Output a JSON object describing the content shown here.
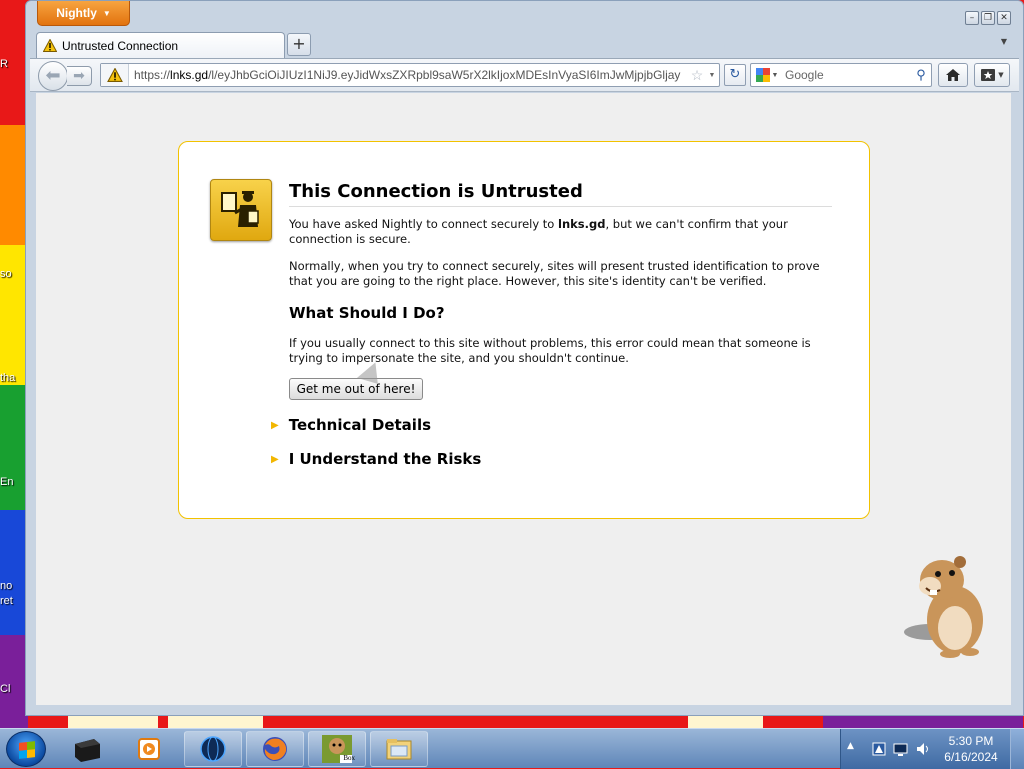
{
  "desktop": {
    "fragments": [
      "R",
      "so",
      "tha",
      "En",
      "no",
      "ret",
      "Cl"
    ]
  },
  "app_menu": {
    "label": "Nightly"
  },
  "tab": {
    "title": "Untrusted Connection"
  },
  "url_bar": {
    "host": "lnks.gd",
    "scheme": "https://",
    "path": "/l/eyJhbGciOiJIUzI1NiJ9.eyJidWxsZXRpbl9saW5rX2lkIjoxMDEsInVyaSI6ImJwMjpjbGljay"
  },
  "search": {
    "placeholder": "Google"
  },
  "error_page": {
    "title": "This Connection is Untrusted",
    "para1_pre": "You have asked Nightly to connect securely to ",
    "para1_host": "lnks.gd",
    "para1_post": ", but we can't confirm that your connection is secure.",
    "para2": "Normally, when you try to connect securely, sites will present trusted identification to prove that you are going to the right place. However, this site's identity can't be verified.",
    "what_title": "What Should I Do?",
    "para3": "If you usually connect to this site without problems, this error could mean that someone is trying to impersonate the site, and you shouldn't continue.",
    "get_out_label": "Get me out of here!",
    "technical_details": "Technical Details",
    "understand_risks": "I Understand the Risks"
  },
  "taskbar": {
    "time": "5:30 PM",
    "date": "6/16/2024",
    "box_label": "Box"
  },
  "colors": {
    "accent_border": "#f2c200",
    "app_button": "#e2730f",
    "taskbar": "#5f86b8"
  }
}
